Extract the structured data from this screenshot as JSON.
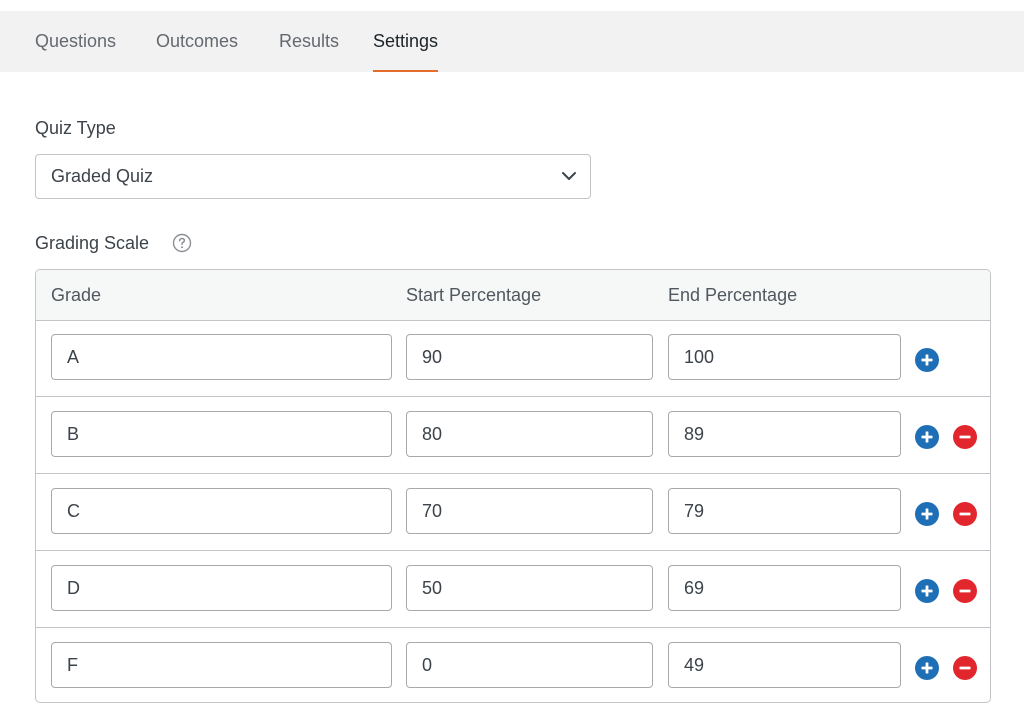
{
  "tabs": [
    {
      "label": "Questions",
      "active": false
    },
    {
      "label": "Outcomes",
      "active": false
    },
    {
      "label": "Results",
      "active": false
    },
    {
      "label": "Settings",
      "active": true
    }
  ],
  "quiz_type": {
    "label": "Quiz Type",
    "selected": "Graded Quiz",
    "icon": "chevron-down-icon"
  },
  "grading_scale": {
    "label": "Grading Scale",
    "help_icon": "question-circle-icon",
    "columns": [
      "Grade",
      "Start Percentage",
      "End Percentage"
    ],
    "rows": [
      {
        "grade": "A",
        "start": "90",
        "end": "100",
        "can_remove": false
      },
      {
        "grade": "B",
        "start": "80",
        "end": "89",
        "can_remove": true
      },
      {
        "grade": "C",
        "start": "70",
        "end": "79",
        "can_remove": true
      },
      {
        "grade": "D",
        "start": "50",
        "end": "69",
        "can_remove": true
      },
      {
        "grade": "F",
        "start": "0",
        "end": "49",
        "can_remove": true
      }
    ]
  },
  "colors": {
    "accent_tab_underline": "#e36e2c",
    "add_button": "#1e6fb6",
    "remove_button": "#e1262d",
    "border": "#c3c4c7"
  }
}
